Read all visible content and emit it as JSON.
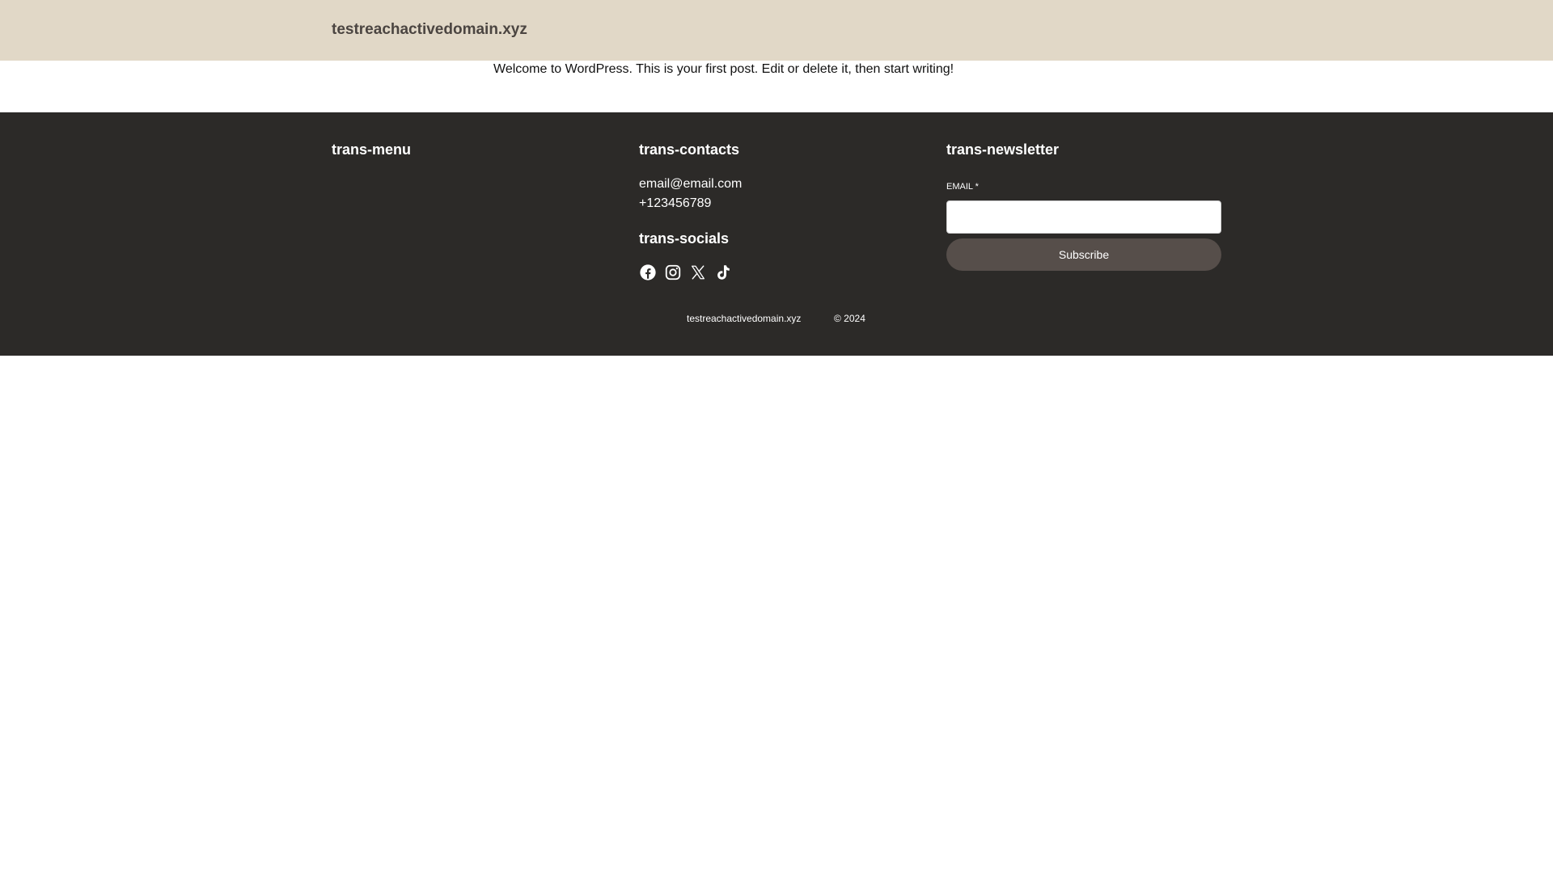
{
  "header": {
    "site_title": "testreachactivedomain.xyz"
  },
  "post": {
    "text": "Welcome to WordPress. This is your first post. Edit or delete it, then start writing!"
  },
  "footer": {
    "menu": {
      "heading": "trans-menu"
    },
    "contacts": {
      "heading": "trans-contacts",
      "email": "email@email.com",
      "phone": "+123456789"
    },
    "socials": {
      "heading": "trans-socials",
      "icons": [
        "facebook-icon",
        "instagram-icon",
        "x-icon",
        "tiktok-icon"
      ]
    },
    "newsletter": {
      "heading": "trans-newsletter",
      "email_label": "EMAIL *",
      "email_value": "",
      "subscribe_label": "Subscribe"
    },
    "bottom": {
      "site_name": "testreachactivedomain.xyz",
      "copyright": "© 2024"
    }
  },
  "colors": {
    "header_bg": "#e1d8c7",
    "footer_bg": "#2c2a28",
    "button_bg": "#564e4a",
    "site_title": "#4b4541"
  }
}
